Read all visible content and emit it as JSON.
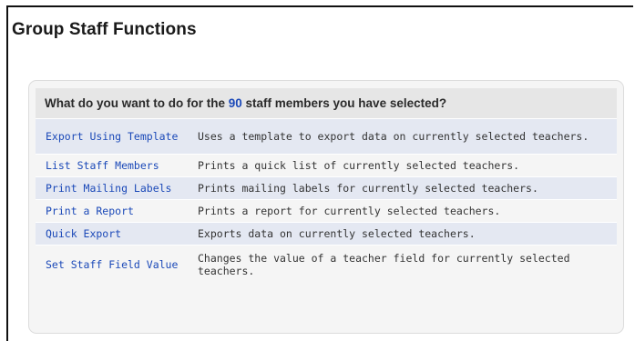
{
  "page": {
    "title": "Group Staff Functions"
  },
  "panel": {
    "question_prefix": "What do you want to do for the ",
    "selected_count": "90",
    "question_suffix": " staff members you have selected?"
  },
  "functions": [
    {
      "label": "Export Using Template",
      "description": "Uses a template to export data on currently selected teachers."
    },
    {
      "label": "List Staff Members",
      "description": "Prints a quick list of currently selected teachers."
    },
    {
      "label": "Print Mailing Labels",
      "description": "Prints mailing labels for currently selected teachers."
    },
    {
      "label": "Print a Report",
      "description": "Prints a report for currently selected teachers."
    },
    {
      "label": "Quick Export",
      "description": "Exports data on currently selected teachers."
    },
    {
      "label": "Set Staff Field Value",
      "description": "Changes the value of a teacher field for currently selected teachers."
    }
  ],
  "colors": {
    "link": "#1b49b8",
    "row_shade": "#e4e8f2",
    "row_plain": "#f5f5f5",
    "header_bg": "#e6e6e6"
  }
}
